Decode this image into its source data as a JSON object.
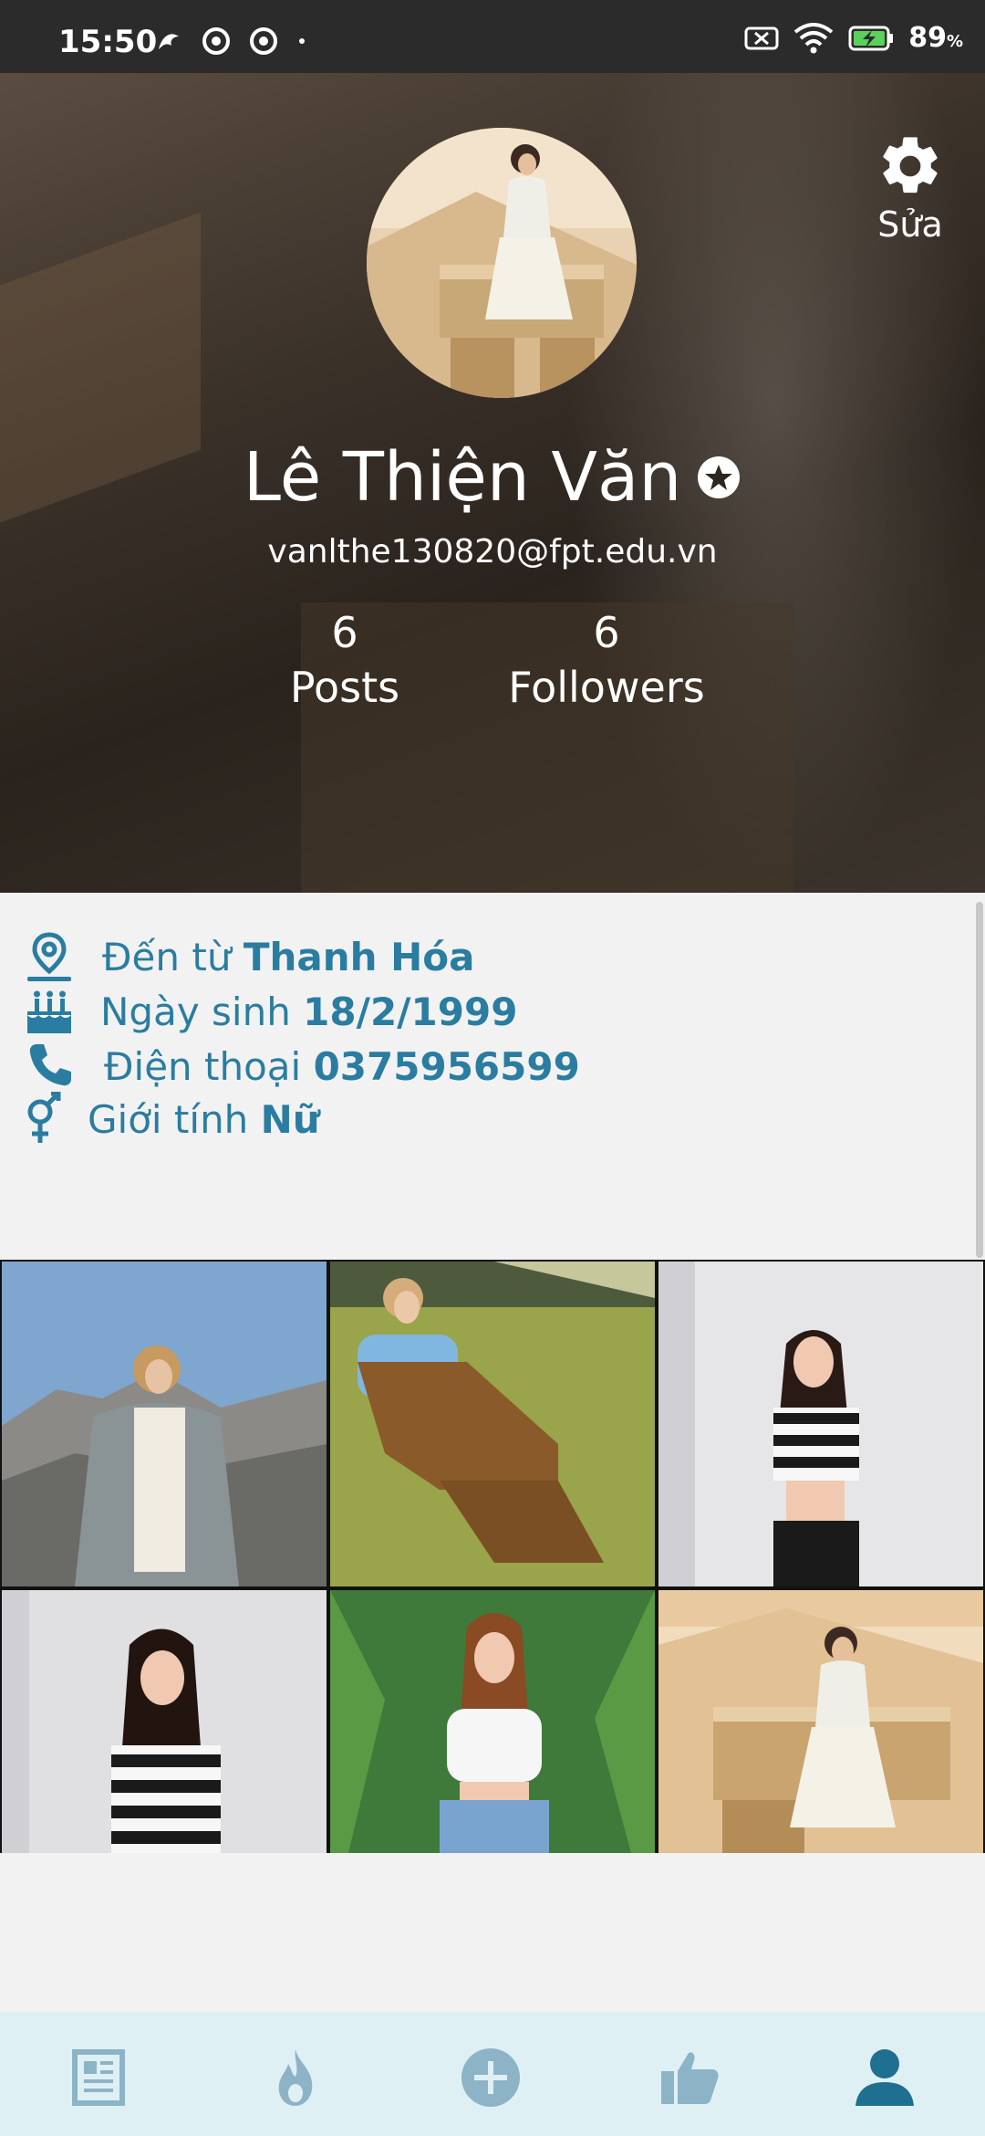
{
  "status_bar": {
    "time": "15:50",
    "battery": "89",
    "battery_unit": "%",
    "icons": [
      "notification-app-icon",
      "notification-app-icon",
      "notification-app-icon",
      "dot-icon",
      "sim-off-icon",
      "wifi-icon",
      "battery-charging-icon"
    ]
  },
  "profile": {
    "name": "Lê Thiện Văn",
    "email": "vanlthe130820@fpt.edu.vn",
    "edit_label": "Sửa",
    "stats": [
      {
        "value": "6",
        "label": "Posts"
      },
      {
        "value": "6",
        "label": "Followers"
      }
    ]
  },
  "info": [
    {
      "icon": "location-pin-icon",
      "label": "Đến từ",
      "value": "Thanh Hóa"
    },
    {
      "icon": "birthday-cake-icon",
      "label": "Ngày sinh",
      "value": "18/2/1999"
    },
    {
      "icon": "phone-icon",
      "label": "Điện thoại",
      "value": "0375956599"
    },
    {
      "icon": "gender-icon",
      "label": "Giới tính",
      "value": "Nữ"
    }
  ],
  "photos": [
    {
      "name": "photo-1"
    },
    {
      "name": "photo-2"
    },
    {
      "name": "photo-3"
    },
    {
      "name": "photo-4"
    },
    {
      "name": "photo-5"
    },
    {
      "name": "photo-6"
    }
  ],
  "bottom_nav": [
    {
      "name": "news-icon",
      "active": false
    },
    {
      "name": "trending-icon",
      "active": false
    },
    {
      "name": "add-post-icon",
      "active": false
    },
    {
      "name": "like-icon",
      "active": false
    },
    {
      "name": "profile-icon",
      "active": true
    }
  ],
  "colors": {
    "accent": "#2a7da0",
    "nav_inactive": "#8cb4c6",
    "nav_bg": "#dff0f5",
    "statusbar_bg": "#2b2b2b"
  }
}
